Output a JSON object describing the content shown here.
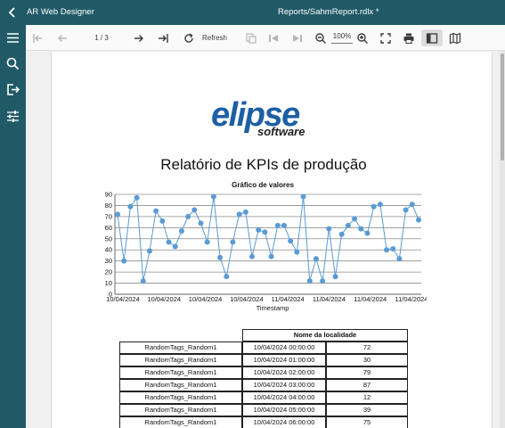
{
  "app": {
    "title": "AR Web Designer",
    "document": "Reports/SahmReport.rdlx *"
  },
  "toolbar": {
    "page_indicator": "1 / 3",
    "refresh_label": "Refresh",
    "zoom_level": "100%"
  },
  "report": {
    "title": "Relatório de KPIs de produção",
    "logo_main": "elipse",
    "logo_sub": "software"
  },
  "chart_data": {
    "type": "line",
    "title": "Gráfico de valores",
    "xlabel": "Timestamp",
    "ylabel": "",
    "ylim": [
      0,
      90
    ],
    "yticks": [
      0,
      10,
      20,
      30,
      40,
      50,
      60,
      70,
      80,
      90
    ],
    "xtick_labels": [
      "10/04/2024",
      "10/04/2024",
      "10/04/2024",
      "10/04/2024",
      "11/04/2024",
      "11/04/2024",
      "11/04/2024",
      "11/04/2024"
    ],
    "grid": true,
    "series": [
      {
        "values": [
          72,
          30,
          79,
          87,
          12,
          39,
          75,
          66,
          47,
          43,
          57,
          70,
          76,
          64,
          47,
          88,
          33,
          16,
          47,
          72,
          74,
          34,
          58,
          56,
          34,
          62,
          62,
          48,
          38,
          88,
          12,
          32,
          12,
          59,
          16,
          54,
          62,
          68,
          59,
          55,
          79,
          81,
          40,
          41,
          32,
          76,
          81,
          67
        ]
      }
    ]
  },
  "table": {
    "header": "Nome da localidade",
    "rows": [
      {
        "tag": "RandomTags_Random1",
        "timestamp": "10/04/2024 00:00:00",
        "value": "72"
      },
      {
        "tag": "RandomTags_Random1",
        "timestamp": "10/04/2024 01:00:00",
        "value": "30"
      },
      {
        "tag": "RandomTags_Random1",
        "timestamp": "10/04/2024 02:00:00",
        "value": "79"
      },
      {
        "tag": "RandomTags_Random1",
        "timestamp": "10/04/2024 03:00:00",
        "value": "87"
      },
      {
        "tag": "RandomTags_Random1",
        "timestamp": "10/04/2024 04:00:00",
        "value": "12"
      },
      {
        "tag": "RandomTags_Random1",
        "timestamp": "10/04/2024 05:00:00",
        "value": "39"
      },
      {
        "tag": "RandomTags_Random1",
        "timestamp": "10/04/2024 06:00:00",
        "value": "75"
      }
    ]
  },
  "colors": {
    "chrome": "#205a66",
    "series": "#5b9bd5",
    "logo": "#1c5fa5"
  }
}
